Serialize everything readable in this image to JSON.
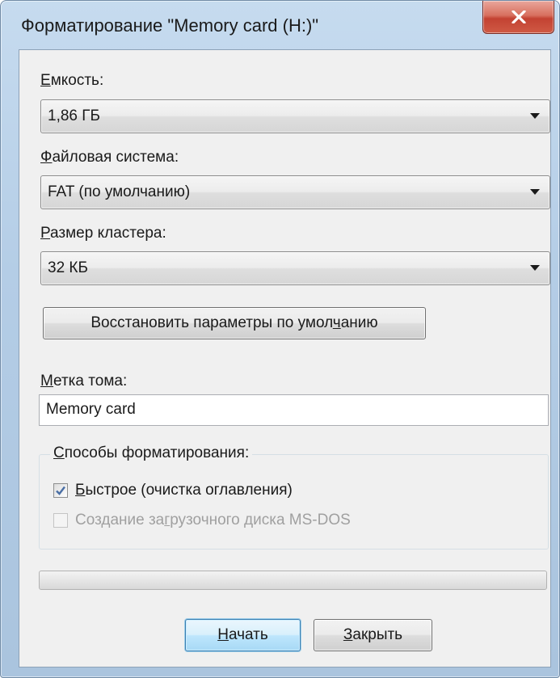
{
  "window": {
    "title": "Форматирование \"Memory card (H:)\""
  },
  "capacity": {
    "label_accel": "Е",
    "label_rest": "мкость:",
    "value": "1,86 ГБ"
  },
  "file_system": {
    "label_accel": "Ф",
    "label_rest": "айловая система:",
    "value": "FAT (по умолчанию)"
  },
  "cluster_size": {
    "label_accel": "Р",
    "label_rest": "азмер кластера:",
    "value": "32 КБ"
  },
  "restore_defaults": {
    "label_before": "Восстановить параметры по умол",
    "label_accel": "ч",
    "label_after": "анию"
  },
  "volume_label": {
    "label_accel": "М",
    "label_rest": "етка тома:",
    "value": "Memory card"
  },
  "format_options": {
    "legend_accel": "С",
    "legend_rest": "пособы форматирования:",
    "quick": {
      "label_accel": "Б",
      "label_rest": "ыстрое (очистка оглавления)",
      "checked": true,
      "enabled": true
    },
    "msdos": {
      "label_before": "Создание за",
      "label_accel": "г",
      "label_after": "рузочного диска MS-DOS",
      "checked": false,
      "enabled": false
    }
  },
  "progress": {
    "value": 0
  },
  "buttons": {
    "start_accel": "Н",
    "start_rest": "ачать",
    "close_accel": "З",
    "close_rest": "акрыть"
  },
  "colors": {
    "close_button": "#c34232",
    "checkmark": "#4a6fa5",
    "default_button_border": "#3c7fb1"
  }
}
